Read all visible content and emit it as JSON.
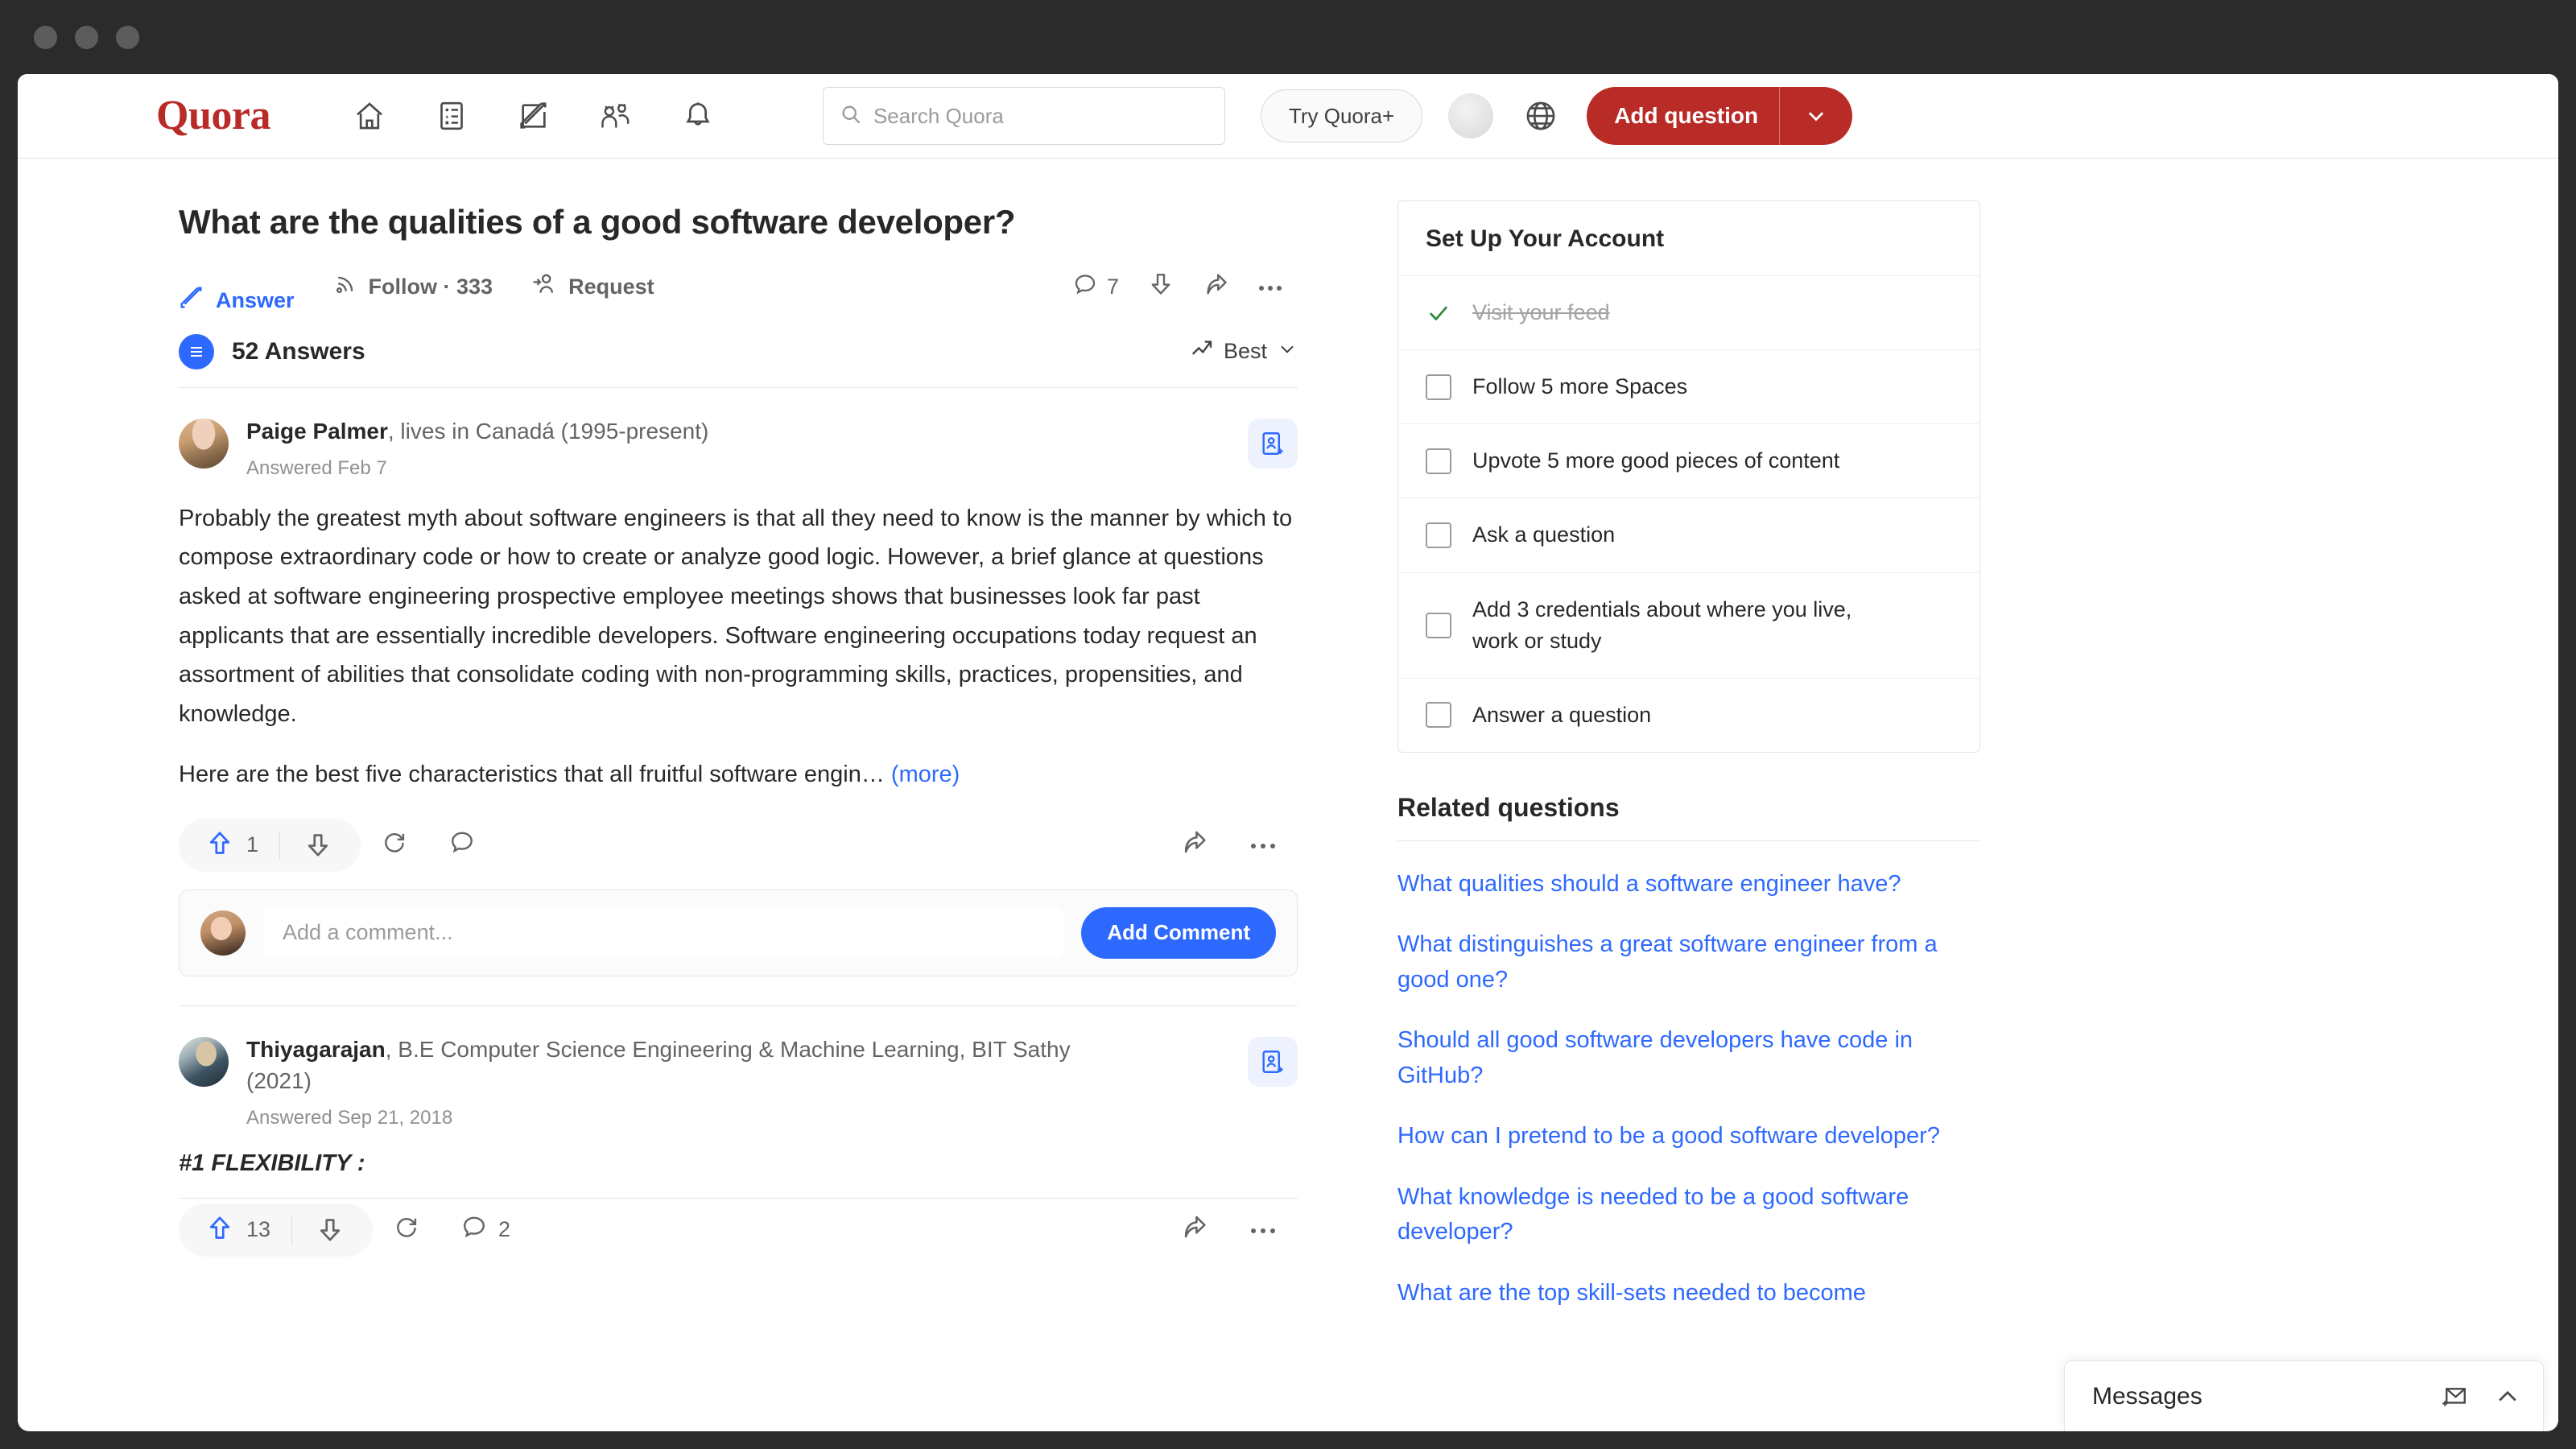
{
  "header": {
    "logo": "Quora",
    "nav": [
      {
        "name": "home",
        "icon": "home-icon"
      },
      {
        "name": "following",
        "icon": "list-icon"
      },
      {
        "name": "answer",
        "icon": "pencil-square-icon"
      },
      {
        "name": "spaces",
        "icon": "people-icon"
      },
      {
        "name": "notifications",
        "icon": "bell-icon"
      }
    ],
    "search_placeholder": "Search Quora",
    "search_value": "",
    "try_plus_label": "Try Quora+",
    "add_question_label": "Add question"
  },
  "question": {
    "title": "What are the qualities of a good software developer?",
    "actions": {
      "answer": "Answer",
      "follow": "Follow · 333",
      "request": "Request",
      "comment_count": "7"
    },
    "answers_count_label": "52 Answers",
    "sort_label": "Best"
  },
  "answers": [
    {
      "author": "Paige Palmer",
      "credential": ", lives in Canadá (1995-present)",
      "date": "Answered Feb 7",
      "paragraphs": [
        "Probably the greatest myth about software engineers is that all they need to know is the manner by which to compose extraordinary code or how to create or analyze good logic. However, a brief glance at questions asked at software engineering prospective employee meetings shows that businesses look far past applicants that are essentially incredible developers. Software engineering occupations today request an assortment of abilities that consolidate coding with non-programming skills, practices, propensities, and knowledge."
      ],
      "teaser": "Here are the best five characteristics that all fruitful software engin…",
      "more_label": "(more)",
      "upvotes": "1",
      "comments": "",
      "avatar_class": "paige"
    },
    {
      "author": "Thiyagarajan",
      "credential": ", B.E Computer Science Engineering & Machine Learning, BIT Sathy (2021)",
      "date": "Answered Sep 21, 2018",
      "heading": "#1 FLEXIBILITY :",
      "upvotes": "13",
      "comments": "2",
      "avatar_class": "thiya"
    }
  ],
  "composer": {
    "placeholder": "Add a comment...",
    "value": "",
    "button_label": "Add Comment"
  },
  "sidebar": {
    "setup_card": {
      "title": "Set Up Your Account",
      "tasks": [
        {
          "label": "Visit your feed",
          "done": true
        },
        {
          "label": "Follow 5 more Spaces",
          "done": false
        },
        {
          "label": "Upvote 5 more good pieces of content",
          "done": false
        },
        {
          "label": "Ask a question",
          "done": false
        },
        {
          "label": "Add 3 credentials about where you live, work or study",
          "done": false
        },
        {
          "label": "Answer a question",
          "done": false
        }
      ]
    },
    "related": {
      "title": "Related questions",
      "items": [
        "What qualities should a software engineer have?",
        "What distinguishes a great software engineer from a good one?",
        "Should all good software developers have code in GitHub?",
        "How can I pretend to be a good software developer?",
        "What knowledge is needed to be a good software developer?",
        "What are the top skill-sets needed to become"
      ]
    }
  },
  "messages_dock": {
    "label": "Messages"
  },
  "colors": {
    "brand_red": "#b92b27",
    "link_blue": "#2e69ff",
    "check_green": "#2b8a3e",
    "text": "#282829",
    "muted": "#636466"
  }
}
